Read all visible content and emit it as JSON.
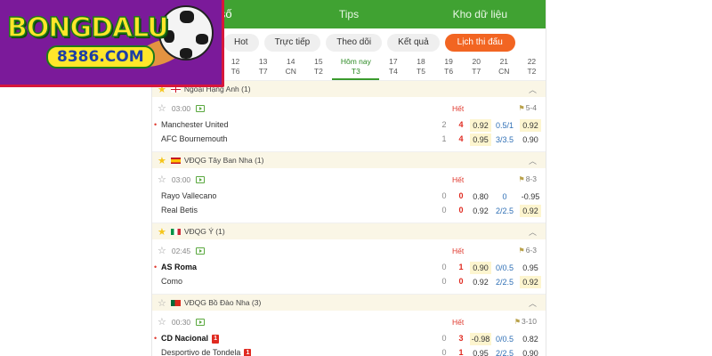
{
  "logo": {
    "brand": "BONGDALU",
    "sub": "8386.COM"
  },
  "nav": {
    "tabs": [
      "Tỷ số",
      "Tips",
      "Kho dữ liệu"
    ],
    "active": 0
  },
  "filters": [
    "Hot",
    "Trực tiếp",
    "Theo dõi",
    "Kết quả",
    "Lịch thi đấu"
  ],
  "dates": [
    {
      "d": "12",
      "w": "T6"
    },
    {
      "d": "13",
      "w": "T7"
    },
    {
      "d": "14",
      "w": "CN"
    },
    {
      "d": "15",
      "w": "T2"
    },
    {
      "d": "Hôm nay",
      "w": "T3"
    },
    {
      "d": "17",
      "w": "T4"
    },
    {
      "d": "18",
      "w": "T5"
    },
    {
      "d": "19",
      "w": "T6"
    },
    {
      "d": "20",
      "w": "T7"
    },
    {
      "d": "21",
      "w": "CN"
    },
    {
      "d": "22",
      "w": "T2"
    }
  ],
  "leagues": [
    {
      "name": "Ngoại Hạng Anh (1)",
      "starred": true,
      "flag": "england",
      "match": {
        "time": "03:00",
        "status": "Hết",
        "corners": "5-4",
        "home": {
          "name": "Manchester United",
          "ht": "2",
          "ft": "4",
          "o1": "0.92",
          "o2": "0.5/1",
          "o3": "0.92",
          "dot": true,
          "bold": false,
          "red": ""
        },
        "away": {
          "name": "AFC Bournemouth",
          "ht": "1",
          "ft": "4",
          "o1": "0.95",
          "o2": "3/3.5",
          "o3": "0.90",
          "dot": false,
          "bold": false,
          "red": ""
        }
      }
    },
    {
      "name": "VĐQG Tây Ban Nha (1)",
      "starred": true,
      "flag": "spain",
      "match": {
        "time": "03:00",
        "status": "Hết",
        "corners": "8-3",
        "home": {
          "name": "Rayo Vallecano",
          "ht": "0",
          "ft": "0",
          "o1": "0.80",
          "o2": "0",
          "o3": "-0.95",
          "dot": false,
          "bold": false,
          "red": ""
        },
        "away": {
          "name": "Real Betis",
          "ht": "0",
          "ft": "0",
          "o1": "0.92",
          "o2": "2/2.5",
          "o3": "0.92",
          "dot": false,
          "bold": false,
          "red": ""
        }
      }
    },
    {
      "name": "VĐQG Ý (1)",
      "starred": true,
      "flag": "italy",
      "match": {
        "time": "02:45",
        "status": "Hết",
        "corners": "6-3",
        "home": {
          "name": "AS Roma",
          "ht": "0",
          "ft": "1",
          "o1": "0.90",
          "o2": "0/0.5",
          "o3": "0.95",
          "dot": true,
          "bold": true,
          "red": ""
        },
        "away": {
          "name": "Como",
          "ht": "0",
          "ft": "0",
          "o1": "0.92",
          "o2": "2/2.5",
          "o3": "0.92",
          "dot": false,
          "bold": false,
          "red": ""
        }
      }
    },
    {
      "name": "VĐQG Bồ Đào Nha (3)",
      "starred": false,
      "flag": "portugal",
      "match": {
        "time": "00:30",
        "status": "Hết",
        "corners": "3-10",
        "home": {
          "name": "CD Nacional",
          "ht": "0",
          "ft": "3",
          "o1": "-0.98",
          "o2": "0/0.5",
          "o3": "0.82",
          "dot": true,
          "bold": true,
          "red": "1"
        },
        "away": {
          "name": "Desportivo de Tondela",
          "ht": "0",
          "ft": "1",
          "o1": "0.95",
          "o2": "2/2.5",
          "o3": "0.90",
          "dot": false,
          "bold": false,
          "red": "1"
        }
      }
    }
  ],
  "colors": {
    "green": "#40a232",
    "orange": "#f26522",
    "red": "#e02a20",
    "blue": "#2f6fb5",
    "highlight": "#fdf5cf"
  }
}
